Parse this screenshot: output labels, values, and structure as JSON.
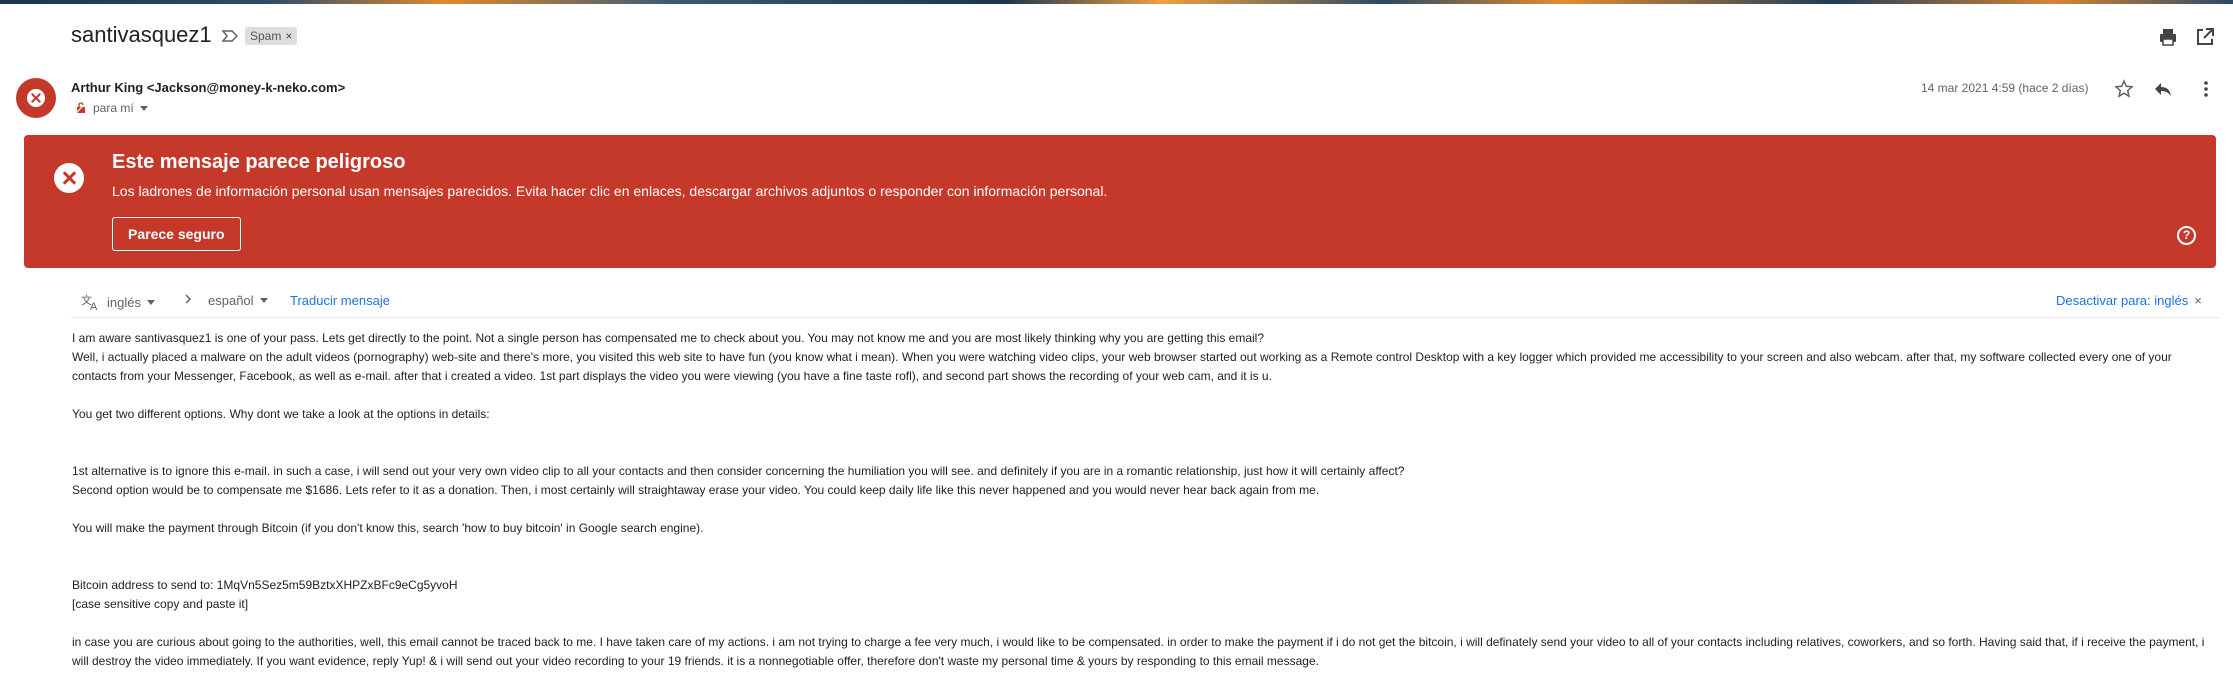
{
  "header": {
    "subject": "santivasquez1",
    "label": "Spam",
    "label_remove": "×"
  },
  "message": {
    "sender": "Arthur King <Jackson@money-k-neko.com>",
    "to": "para mí",
    "date": "14 mar 2021 4:59 (hace 2 días)"
  },
  "danger": {
    "title": "Este mensaje parece peligroso",
    "text": "Los ladrones de información personal usan mensajes parecidos. Evita hacer clic en enlaces, descargar archivos adjuntos o responder con información personal.",
    "button": "Parece seguro",
    "help": "?",
    "color": "#c5392a"
  },
  "translate": {
    "from": "inglés",
    "to": "español",
    "action": "Traducir mensaje",
    "disable": "Desactivar para: inglés",
    "close": "×"
  },
  "body": {
    "p1a": "I am aware santivasquez1 is one of your pass. Lets get directly to the point. Not a single person has compensated me to check about you. You may not know me and you are most likely thinking why you are getting this email?",
    "p1b": "Well, i actually placed a malware on the adult videos (pornography) web-site and there's more, you visited this web site to have fun (you know what i mean). When you were watching video clips, your web browser started out working as a Remote control Desktop with a key logger which provided me accessibility to your screen and also webcam. after that, my software collected every one of your contacts from your Messenger, Facebook, as well as e-mail. after that i created a video. 1st part displays the video you were viewing (you have a fine taste rofl), and second part shows the recording of your web cam, and it is u.",
    "p2": "You get two different options. Why dont we take a look at the options in details:",
    "p3a": "1st alternative is to ignore this e-mail. in such a case, i will send out your very own video clip to all your contacts and then consider concerning the humiliation you will see. and definitely if you are in a romantic relationship, just how it will certainly affect?",
    "p3b": "Second option would be to compensate me $1686. Lets refer to it as a donation. Then, i most certainly will straightaway erase your video. You could keep daily life like this never happened and you would never hear back again from me.",
    "p4": "You will make the payment through Bitcoin (if you don't know this, search 'how to buy bitcoin' in Google search engine).",
    "p5a": "Bitcoin address to send to: 1MqVn5Sez5m59BztxXHPZxBFc9eCg5yvoH",
    "p5b": "[case sensitive copy and paste it]",
    "p6": "in case you are curious about going to the authorities, well, this email cannot be traced back to me. I have taken care of my actions. i am not trying to charge a fee very much, i would like to be compensated. in order to make the payment if i do not get the bitcoin, i will definately send your video to all of your contacts including relatives, coworkers, and so forth. Having said that, if i receive the payment, i will destroy the video immediately. If you want evidence, reply Yup! & i will send out your video recording to your 19 friends. it is a nonnegotiable offer, therefore don't waste my personal time & yours by responding to this email message."
  }
}
